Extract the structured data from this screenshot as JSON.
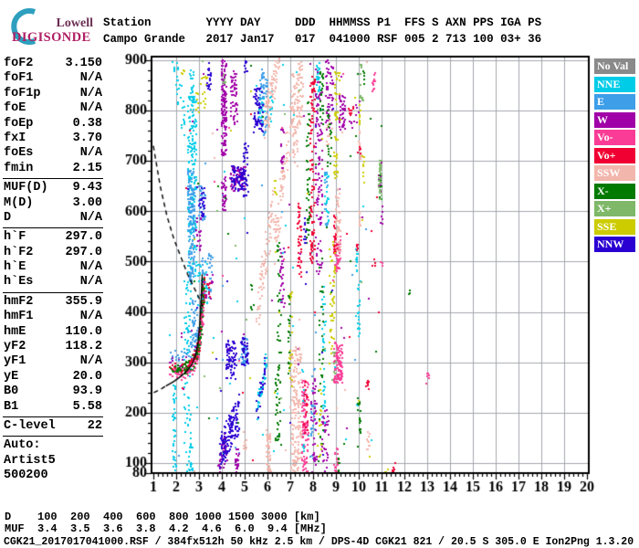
{
  "logo": {
    "top": "Lowell",
    "bottom": "DIGISONDE",
    "arc_color": "#2E9FBE",
    "top_color": "#6B2D52",
    "bottom_color": "#B01F63"
  },
  "header": {
    "line1": "Station        YYYY DAY     DDD  HHMMSS P1  FFS S AXN PPS IGA PS",
    "line2": "Campo Grande   2017 Jan17   017  041000 RSF 005 2 713 100 03+ 36"
  },
  "params": [
    {
      "label": "foF2",
      "value": "3.150"
    },
    {
      "label": "foF1",
      "value": "N/A"
    },
    {
      "label": "foF1p",
      "value": "N/A"
    },
    {
      "label": "foE",
      "value": "N/A"
    },
    {
      "label": "foEp",
      "value": "0.38"
    },
    {
      "label": "fxI",
      "value": "3.70"
    },
    {
      "label": "foEs",
      "value": "N/A"
    },
    {
      "label": "fmin",
      "value": "2.15"
    },
    {
      "sep": true
    },
    {
      "label": "MUF(D)",
      "value": "9.43"
    },
    {
      "label": "M(D)",
      "value": "3.00"
    },
    {
      "label": "D",
      "value": "N/A"
    },
    {
      "sep": true
    },
    {
      "label": "h`F",
      "value": "297.0"
    },
    {
      "label": "h`F2",
      "value": "297.0"
    },
    {
      "label": "h`E",
      "value": "N/A"
    },
    {
      "label": "h`Es",
      "value": "N/A"
    },
    {
      "sep": true
    },
    {
      "label": "hmF2",
      "value": "355.9"
    },
    {
      "label": "hmF1",
      "value": "N/A"
    },
    {
      "label": "hmE",
      "value": "110.0"
    },
    {
      "label": "yF2",
      "value": "118.2"
    },
    {
      "label": "yF1",
      "value": "N/A"
    },
    {
      "label": "yE",
      "value": "20.0"
    },
    {
      "label": "B0",
      "value": "93.9"
    },
    {
      "label": "B1",
      "value": "5.58"
    },
    {
      "sep": true
    },
    {
      "label": "C-level",
      "value": "22"
    },
    {
      "sep": true
    },
    {
      "label": "Auto:",
      "value": ""
    },
    {
      "label": "Artist5",
      "value": ""
    },
    {
      "label": "500200",
      "value": ""
    }
  ],
  "legend": [
    {
      "label": "No Val",
      "color": "#8A8A8A"
    },
    {
      "label": "NNE",
      "color": "#00CCE8"
    },
    {
      "label": "E",
      "color": "#3E9EE8"
    },
    {
      "label": "W",
      "color": "#A000A8"
    },
    {
      "label": "Vo-",
      "color": "#FA3C96"
    },
    {
      "label": "Vo+",
      "color": "#F00032"
    },
    {
      "label": "SSW",
      "color": "#F2B6AC"
    },
    {
      "label": "X-",
      "color": "#007A00"
    },
    {
      "label": "X+",
      "color": "#7EB868"
    },
    {
      "label": "SSE",
      "color": "#CCCC00"
    },
    {
      "label": "NNW",
      "color": "#2A00D2"
    }
  ],
  "dmuf": {
    "d_row": "D    100  200  400  600  800 1000 1500 3000 [km]",
    "muf_row": "MUF  3.4  3.5  3.6  3.8  4.2  4.6  6.0  9.4 [MHz]"
  },
  "footer": "CGK21_2017017041000.RSF / 384fx512h 50 kHz 2.5 km / DPS-4D CGK21 821 / 20.5 S 305.0 E Ion2Png 1.3.20",
  "chart_data": {
    "type": "scatter",
    "title": "Digisonde ionogram, Campo Grande, 2017 Jan17 day 017, 04:10:00",
    "xlabel": "[MHz]",
    "ylabel": "[km]",
    "xlim": [
      1,
      20
    ],
    "ylim": [
      80,
      900
    ],
    "x_ticks": [
      1,
      2,
      3,
      4,
      5,
      6,
      7,
      8,
      9,
      10,
      11,
      12,
      13,
      14,
      15,
      16,
      17,
      18,
      19,
      20
    ],
    "y_ticks": [
      100,
      200,
      300,
      400,
      500,
      600,
      700,
      800,
      900
    ],
    "y_extra_tick_label": 80,
    "x_minor_step": 0.2,
    "y_minor_step": 20,
    "grid": true,
    "legend_position": "right",
    "grid_color": "#A3A7AE",
    "seed": 7,
    "colors": {
      "NoVal": "#8A8A8A",
      "NNE": "#00CCE8",
      "E": "#3E9EE8",
      "W": "#A000A8",
      "Vo-": "#FA3C96",
      "Vo+": "#F00032",
      "SSW": "#F2B6AC",
      "X-": "#007A00",
      "X+": "#7EB868",
      "SSE": "#CCCC00",
      "NNW": "#2A00D2"
    },
    "trace": {
      "comment": "F2-layer echo trace, foF2 3.15 MHz, h`F 297 km; [MHz,km] spine",
      "path": [
        [
          1.72,
          288
        ],
        [
          1.95,
          285
        ],
        [
          2.2,
          284
        ],
        [
          2.45,
          287
        ],
        [
          2.65,
          294
        ],
        [
          2.8,
          303
        ],
        [
          2.95,
          322
        ],
        [
          3.05,
          350
        ],
        [
          3.12,
          385
        ],
        [
          3.17,
          420
        ],
        [
          3.2,
          450
        ]
      ],
      "n": 420,
      "fjit": 0.05,
      "kjit": 8,
      "mix": [
        [
          "X-",
          0.44,
          0
        ],
        [
          "Vo-",
          0.24,
          -8
        ],
        [
          "Vo+",
          0.14,
          3
        ],
        [
          "W",
          0.08,
          16
        ],
        [
          "E",
          0.1,
          28
        ]
      ]
    },
    "clusters_format": [
      "color",
      "f_min_MHz",
      "f_max_MHz",
      "km_min",
      "km_max",
      "n_dots",
      "diagonal_flag",
      "km_jitter"
    ],
    "clusters": [
      [
        "NNE",
        2.5,
        2.9,
        470,
        830,
        200
      ],
      [
        "NNE",
        2.35,
        2.65,
        80,
        470,
        75
      ],
      [
        "NNE",
        1.85,
        2.0,
        80,
        260,
        40
      ],
      [
        "NNE",
        1.9,
        2.35,
        900,
        772,
        32,
        1,
        30
      ],
      [
        "NNE",
        2.6,
        2.78,
        820,
        885,
        20
      ],
      [
        "NNE",
        5.5,
        5.95,
        190,
        300,
        38,
        1,
        22
      ],
      [
        "NNE",
        5.6,
        5.9,
        770,
        830,
        20
      ],
      [
        "NNE",
        8.15,
        8.3,
        820,
        900,
        26
      ],
      [
        "NNE",
        8.5,
        8.7,
        565,
        680,
        24
      ],
      [
        "NNE",
        8.4,
        8.55,
        155,
        455,
        38
      ],
      [
        "NNE",
        9.85,
        9.95,
        475,
        525,
        13
      ],
      [
        "NNE",
        9.95,
        10.1,
        350,
        470,
        20
      ],
      [
        "NNE",
        6.1,
        6.25,
        775,
        845,
        16
      ],
      [
        "NNE",
        7.5,
        7.62,
        95,
        295,
        16
      ],
      [
        "NNE",
        2.55,
        2.75,
        80,
        135,
        20
      ],
      [
        "NNE",
        2.95,
        3.45,
        410,
        500,
        26
      ],
      [
        "NNE",
        1.7,
        11.0,
        80,
        900,
        40
      ],
      [
        "E",
        2.5,
        2.85,
        560,
        680,
        100
      ],
      [
        "E",
        2.55,
        2.8,
        460,
        560,
        55
      ],
      [
        "E",
        2.65,
        2.95,
        330,
        430,
        40
      ],
      [
        "E",
        3.0,
        3.3,
        580,
        650,
        35
      ],
      [
        "E",
        4.85,
        5.15,
        290,
        350,
        40
      ],
      [
        "E",
        5.6,
        6.0,
        750,
        868,
        55
      ],
      [
        "E",
        7.9,
        8.1,
        100,
        295,
        24
      ],
      [
        "E",
        5.75,
        5.85,
        852,
        884,
        8
      ],
      [
        "E",
        8.5,
        8.65,
        565,
        680,
        14
      ],
      [
        "E",
        3.1,
        3.6,
        440,
        515,
        35
      ],
      [
        "E",
        2.0,
        10.5,
        80,
        900,
        22
      ],
      [
        "W",
        3.98,
        4.22,
        709,
        900,
        150
      ],
      [
        "W",
        4.0,
        4.2,
        597,
        671,
        34
      ],
      [
        "W",
        4.38,
        4.68,
        772,
        879,
        52
      ],
      [
        "W",
        4.35,
        5.05,
        640,
        690,
        65
      ],
      [
        "W",
        3.88,
        4.25,
        80,
        150,
        42,
        1,
        30
      ],
      [
        "W",
        8.55,
        8.9,
        762,
        900,
        60
      ],
      [
        "W",
        9.15,
        9.4,
        756,
        832,
        42
      ],
      [
        "W",
        8.4,
        8.7,
        80,
        210,
        32
      ],
      [
        "W",
        6.55,
        6.75,
        411,
        539,
        30
      ],
      [
        "W",
        6.6,
        6.72,
        677,
        762,
        20
      ],
      [
        "W",
        7.9,
        8.15,
        80,
        273,
        42
      ],
      [
        "W",
        8.1,
        8.4,
        475,
        900,
        105
      ],
      [
        "W",
        2.88,
        3.1,
        520,
        590,
        18
      ],
      [
        "W",
        10.88,
        11.0,
        629,
        700,
        9
      ],
      [
        "W",
        10.95,
        11.05,
        571,
        613,
        6
      ],
      [
        "W",
        4.6,
        4.75,
        80,
        135,
        20
      ],
      [
        "W",
        9.6,
        10.1,
        762,
        825,
        11
      ],
      [
        "W",
        3.3,
        3.6,
        425,
        480,
        13
      ],
      [
        "W",
        2.0,
        11.0,
        80,
        900,
        28
      ],
      [
        "Vo-",
        8.9,
        9.3,
        257,
        340,
        95
      ],
      [
        "Vo-",
        8.95,
        9.2,
        480,
        550,
        50
      ],
      [
        "Vo-",
        7.5,
        7.8,
        80,
        265,
        100
      ],
      [
        "Vo-",
        8.9,
        9.1,
        80,
        130,
        20
      ],
      [
        "Vo-",
        10.6,
        10.75,
        836,
        880,
        11
      ],
      [
        "Vo-",
        12.95,
        13.1,
        255,
        280,
        7
      ],
      [
        "Vo-",
        10.95,
        11.05,
        486,
        500,
        4
      ],
      [
        "Vo-",
        2.2,
        10.5,
        80,
        900,
        9
      ],
      [
        "Vo+",
        7.87,
        8.07,
        496,
        880,
        95
      ],
      [
        "Vo+",
        7.3,
        7.5,
        464,
        634,
        42
      ],
      [
        "Vo+",
        8.9,
        9.05,
        517,
        597,
        33
      ],
      [
        "Vo+",
        7.95,
        8.1,
        836,
        868,
        11
      ],
      [
        "Vo+",
        7.6,
        7.8,
        156,
        263,
        18
      ],
      [
        "Vo+",
        9.55,
        9.75,
        788,
        815,
        9
      ],
      [
        "Vo+",
        10.3,
        10.45,
        231,
        268,
        8
      ],
      [
        "Vo+",
        11.45,
        11.6,
        80,
        100,
        7
      ],
      [
        "Vo+",
        9.9,
        10.0,
        523,
        539,
        5
      ],
      [
        "Vo+",
        10.6,
        10.75,
        491,
        507,
        5
      ],
      [
        "Vo+",
        9.9,
        10.1,
        714,
        730,
        5
      ],
      [
        "Vo+",
        3.2,
        3.5,
        425,
        470,
        11
      ],
      [
        "Vo+",
        2.1,
        11.0,
        80,
        900,
        13
      ],
      [
        "SSW",
        5.9,
        6.5,
        772,
        900,
        75,
        1,
        35
      ],
      [
        "SSW",
        7.0,
        7.35,
        687,
        880,
        75
      ],
      [
        "SSW",
        7.3,
        7.55,
        772,
        900,
        50
      ],
      [
        "SSW",
        5.95,
        6.15,
        80,
        165,
        42
      ],
      [
        "SSW",
        7.05,
        7.5,
        80,
        330,
        160
      ],
      [
        "SSW",
        9.0,
        9.2,
        512,
        650,
        50
      ],
      [
        "SSW",
        10.0,
        10.1,
        571,
        624,
        8
      ],
      [
        "SSW",
        10.0,
        10.12,
        703,
        762,
        9
      ],
      [
        "SSW",
        10.35,
        10.5,
        80,
        165,
        12
      ],
      [
        "SSW",
        5.55,
        6.3,
        400,
        620,
        75,
        1,
        40
      ],
      [
        "SSW",
        6.35,
        6.9,
        540,
        740,
        65,
        1,
        40
      ],
      [
        "SSW",
        8.55,
        8.75,
        730,
        794,
        12
      ],
      [
        "SSW",
        4.95,
        5.1,
        120,
        165,
        8
      ],
      [
        "SSW",
        2.5,
        10.8,
        80,
        900,
        18
      ],
      [
        "X-",
        6.35,
        6.55,
        135,
        295,
        36
      ],
      [
        "X-",
        6.4,
        6.6,
        316,
        540,
        27
      ],
      [
        "X-",
        7.7,
        7.85,
        528,
        825,
        45
      ],
      [
        "X-",
        8.3,
        8.45,
        772,
        879,
        24
      ],
      [
        "X-",
        8.25,
        8.45,
        103,
        455,
        32
      ],
      [
        "X-",
        9.95,
        10.1,
        156,
        231,
        16
      ],
      [
        "X-",
        8.65,
        8.8,
        687,
        804,
        20
      ],
      [
        "X-",
        10.15,
        10.25,
        852,
        890,
        7
      ],
      [
        "X-",
        12.15,
        12.25,
        422,
        443,
        4
      ],
      [
        "X-",
        9.1,
        9.2,
        80,
        110,
        6
      ],
      [
        "X-",
        6.9,
        7.0,
        263,
        432,
        20
      ],
      [
        "X-",
        10.88,
        11.0,
        624,
        687,
        8
      ],
      [
        "X-",
        5.25,
        5.4,
        401,
        454,
        8
      ],
      [
        "X-",
        2.0,
        11.0,
        80,
        900,
        25
      ],
      [
        "X+",
        10.88,
        11.0,
        624,
        703,
        32
      ],
      [
        "X+",
        10.05,
        10.2,
        815,
        852,
        9
      ],
      [
        "X+",
        10.05,
        10.15,
        873,
        895,
        5
      ],
      [
        "X+",
        4.05,
        4.2,
        847,
        879,
        6
      ],
      [
        "X+",
        8.85,
        9.0,
        263,
        326,
        8
      ],
      [
        "X+",
        2.5,
        11.0,
        80,
        900,
        12
      ],
      [
        "SSE",
        8.7,
        9.0,
        294,
        540,
        45
      ],
      [
        "SSE",
        8.95,
        9.2,
        772,
        884,
        27
      ],
      [
        "SSE",
        8.9,
        9.1,
        666,
        751,
        23
      ],
      [
        "SSE",
        6.95,
        7.1,
        252,
        443,
        20
      ],
      [
        "SSE",
        3.05,
        3.35,
        804,
        879,
        14
      ],
      [
        "SSE",
        2.85,
        3.0,
        794,
        841,
        8
      ],
      [
        "SSE",
        8.2,
        8.4,
        103,
        294,
        16
      ],
      [
        "SSE",
        11.15,
        11.3,
        80,
        95,
        6
      ],
      [
        "SSE",
        10.15,
        10.25,
        640,
        714,
        8
      ],
      [
        "SSE",
        10.0,
        10.1,
        767,
        815,
        8
      ],
      [
        "SSE",
        6.3,
        6.4,
        624,
        666,
        6
      ],
      [
        "SSE",
        2.25,
        2.35,
        868,
        884,
        4
      ],
      [
        "SSE",
        2.2,
        11.2,
        80,
        900,
        16
      ],
      [
        "NNW",
        3.95,
        4.75,
        120,
        200,
        140,
        1,
        38
      ],
      [
        "NNW",
        4.2,
        4.65,
        265,
        345,
        70
      ],
      [
        "NNW",
        4.4,
        5.05,
        640,
        692,
        70
      ],
      [
        "NNW",
        4.85,
        5.15,
        290,
        350,
        35
      ],
      [
        "NNW",
        5.4,
        5.8,
        756,
        847,
        55
      ],
      [
        "NNW",
        5.5,
        5.95,
        195,
        300,
        26,
        1,
        22
      ],
      [
        "NNW",
        3.35,
        3.55,
        841,
        900,
        20
      ],
      [
        "NNW",
        7.6,
        7.7,
        533,
        587,
        11
      ],
      [
        "NNW",
        3.0,
        3.3,
        580,
        650,
        26
      ],
      [
        "NNW",
        5.0,
        5.15,
        873,
        900,
        8
      ],
      [
        "NNW",
        4.95,
        5.15,
        624,
        735,
        32
      ],
      [
        "NNW",
        2.5,
        10.5,
        80,
        900,
        16
      ]
    ],
    "curves": {
      "muf_transmission_dashed": [
        [
          1.0,
          730
        ],
        [
          1.3,
          650
        ],
        [
          1.6,
          590
        ],
        [
          1.9,
          545
        ],
        [
          2.2,
          510
        ],
        [
          2.5,
          475
        ],
        [
          2.8,
          447
        ],
        [
          3.0,
          428
        ],
        [
          3.15,
          412
        ]
      ],
      "profile_dashed": [
        [
          1.02,
          240
        ],
        [
          1.3,
          246
        ],
        [
          1.55,
          253
        ]
      ],
      "profile_solid": [
        [
          1.55,
          253
        ],
        [
          1.9,
          262
        ],
        [
          2.2,
          272
        ],
        [
          2.5,
          284
        ],
        [
          2.7,
          297
        ],
        [
          2.85,
          315
        ],
        [
          2.95,
          338
        ],
        [
          3.02,
          368
        ],
        [
          3.07,
          405
        ],
        [
          3.11,
          440
        ],
        [
          3.14,
          475
        ]
      ]
    }
  }
}
